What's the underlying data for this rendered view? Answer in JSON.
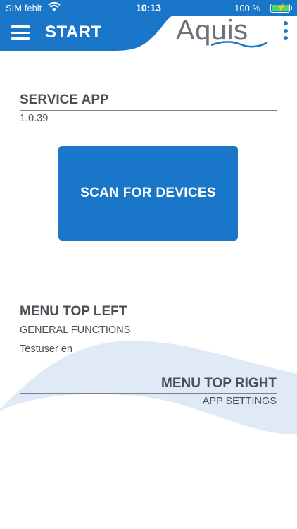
{
  "status_bar": {
    "carrier": "SIM fehlt",
    "time": "10:13",
    "battery": "100 %",
    "wifi_icon": "wifi-icon",
    "battery_icon": "battery-charging-icon"
  },
  "header": {
    "title": "START",
    "logo": "Aquis",
    "menu_icon": "hamburger-menu-icon",
    "more_icon": "vertical-dots-icon"
  },
  "service": {
    "title": "SERVICE APP",
    "version": "1.0.39"
  },
  "scan_button": "SCAN FOR DEVICES",
  "menu_left": {
    "title": "MENU TOP LEFT",
    "subtitle": "GENERAL FUNCTIONS"
  },
  "user": "Testuser en",
  "menu_right": {
    "title": "MENU TOP RIGHT",
    "subtitle": "APP SETTINGS"
  },
  "colors": {
    "primary": "#1976c8",
    "text": "#4a4f55",
    "wave": "#dde9f5"
  }
}
